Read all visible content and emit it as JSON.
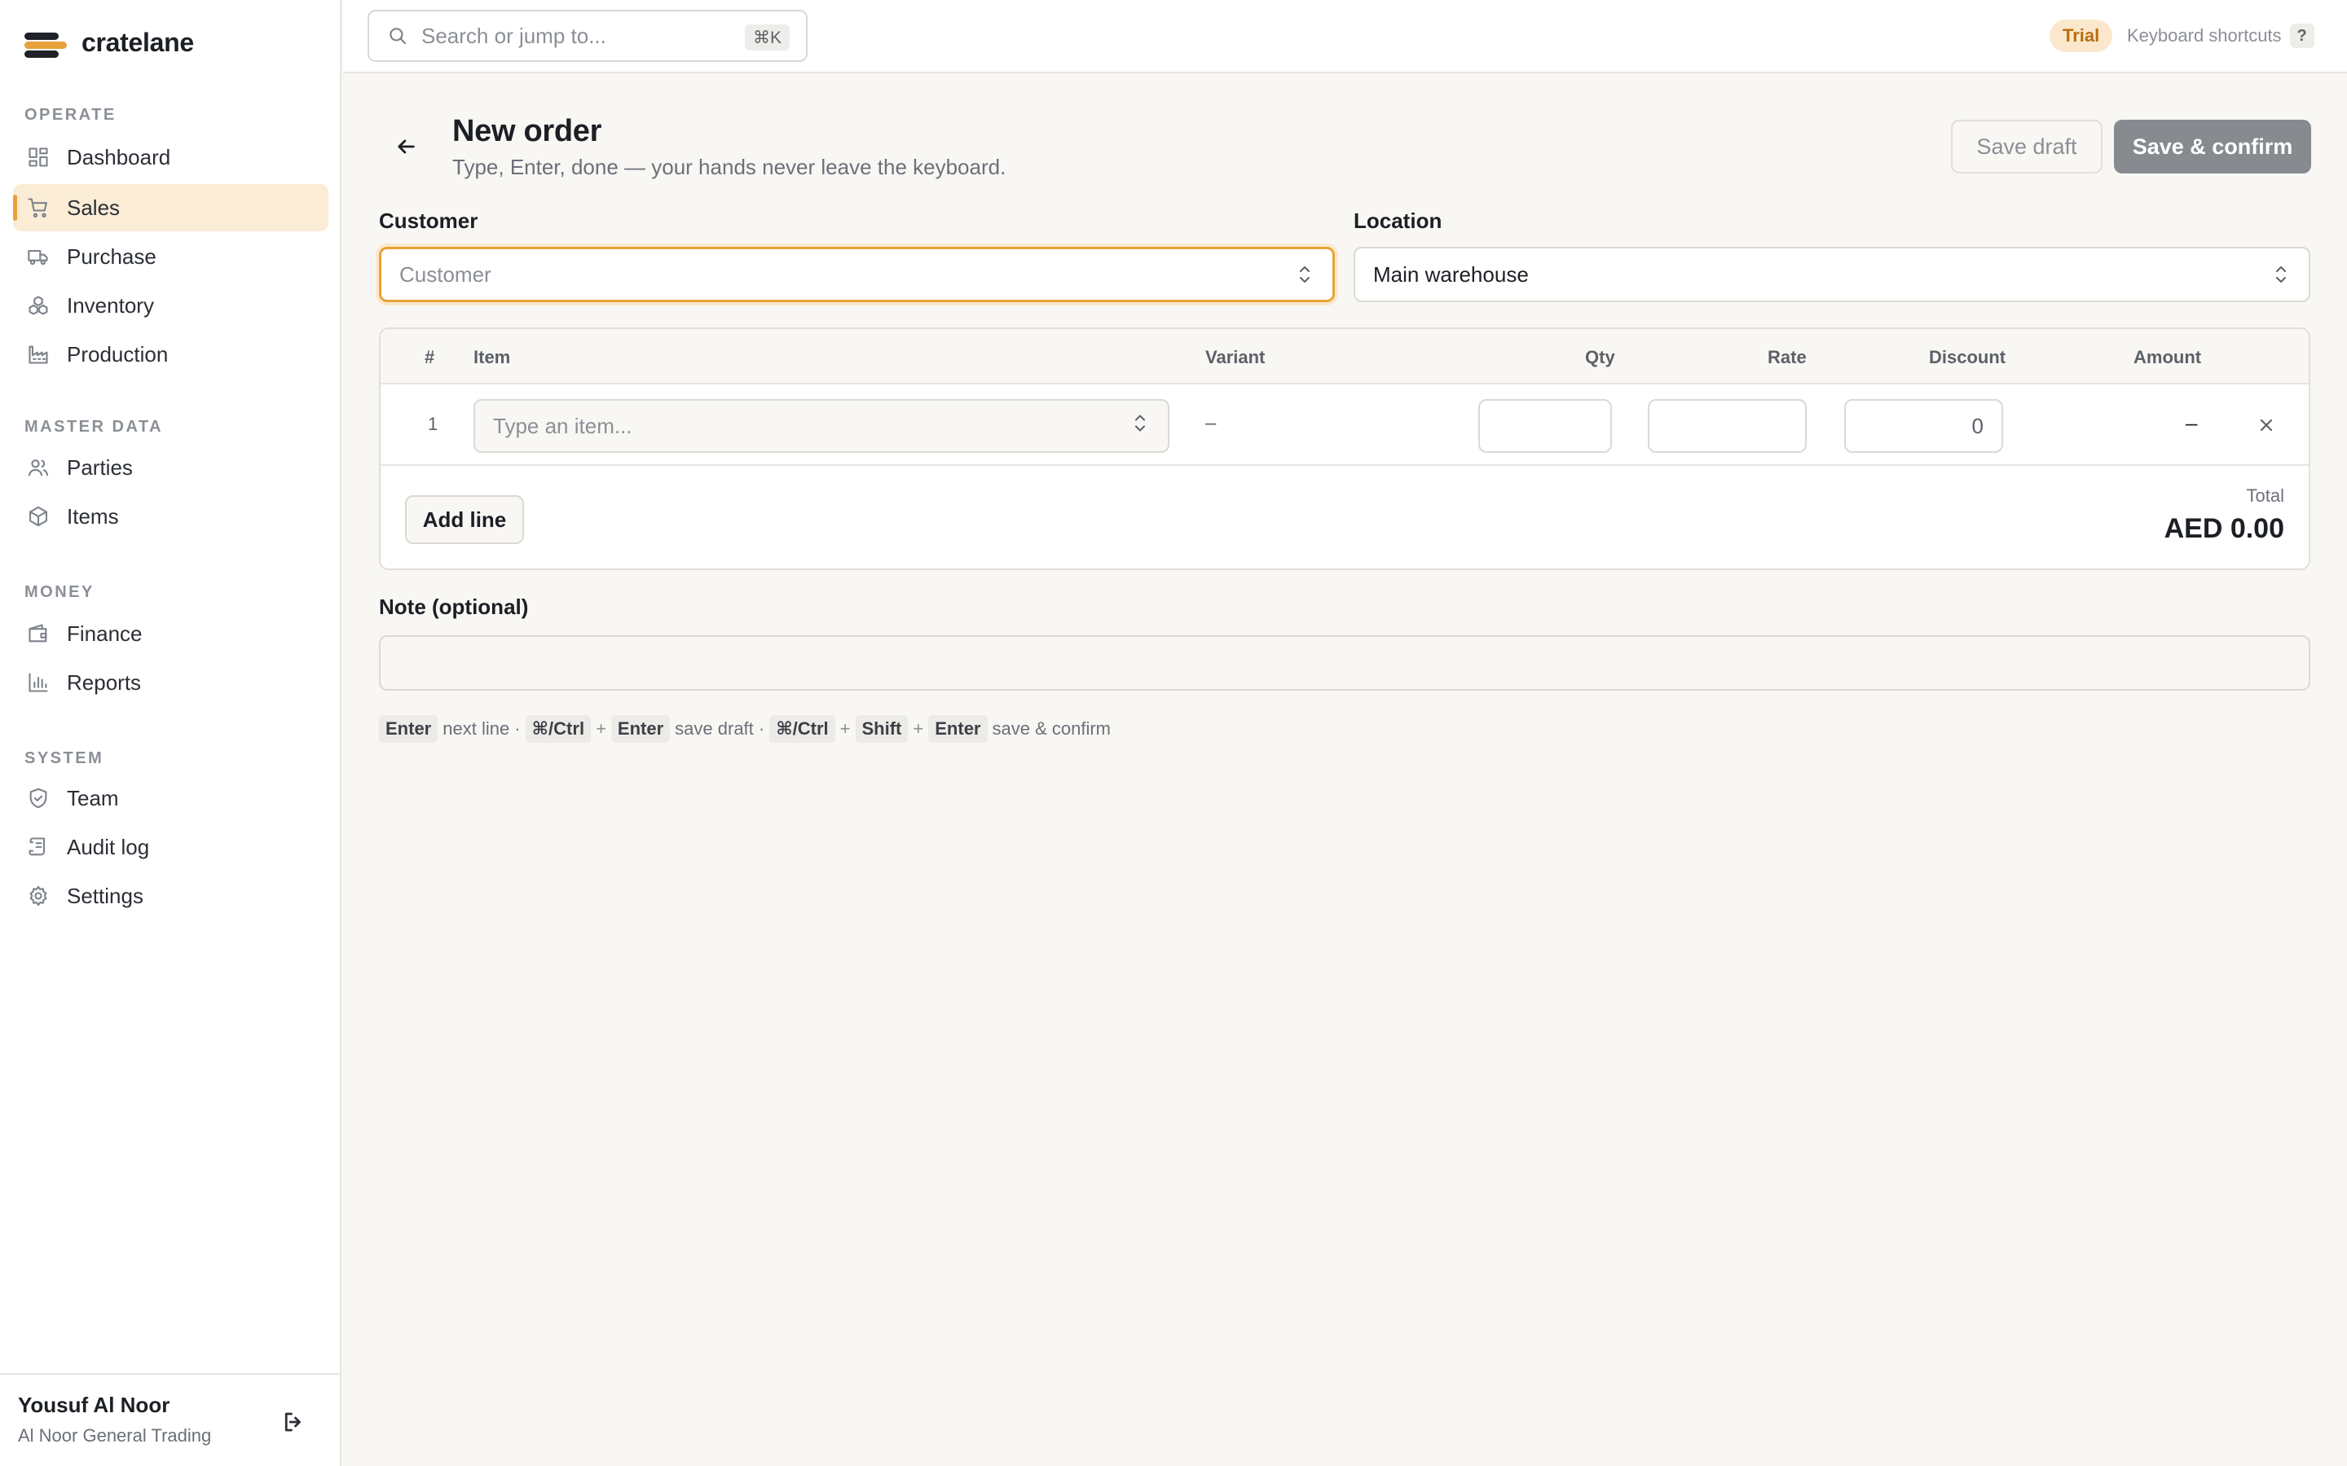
{
  "brand": {
    "name": "cratelane"
  },
  "sidebar": {
    "groups": [
      {
        "label": "OPERATE",
        "items": [
          {
            "label": "Dashboard",
            "icon": "dashboard-icon"
          },
          {
            "label": "Sales",
            "icon": "cart-icon",
            "active": true
          },
          {
            "label": "Purchase",
            "icon": "truck-icon"
          },
          {
            "label": "Inventory",
            "icon": "boxes-icon"
          },
          {
            "label": "Production",
            "icon": "factory-icon"
          }
        ]
      },
      {
        "label": "MASTER DATA",
        "items": [
          {
            "label": "Parties",
            "icon": "users-icon"
          },
          {
            "label": "Items",
            "icon": "package-icon"
          }
        ]
      },
      {
        "label": "MONEY",
        "items": [
          {
            "label": "Finance",
            "icon": "wallet-icon"
          },
          {
            "label": "Reports",
            "icon": "bar-chart-icon"
          }
        ]
      },
      {
        "label": "SYSTEM",
        "items": [
          {
            "label": "Team",
            "icon": "shield-icon"
          },
          {
            "label": "Audit log",
            "icon": "scroll-icon"
          },
          {
            "label": "Settings",
            "icon": "gear-icon"
          }
        ]
      }
    ],
    "user": {
      "name": "Yousuf Al Noor",
      "org": "Al Noor General Trading"
    }
  },
  "topbar": {
    "search_placeholder": "Search or jump to...",
    "search_shortcut": "⌘K",
    "trial_badge": "Trial",
    "shortcuts_label": "Keyboard shortcuts",
    "shortcuts_key": "?"
  },
  "page": {
    "title": "New order",
    "subtitle": "Type, Enter, done — your hands never leave the keyboard.",
    "save_draft_label": "Save draft",
    "save_confirm_label": "Save & confirm"
  },
  "form": {
    "customer": {
      "label": "Customer",
      "placeholder": "Customer"
    },
    "location": {
      "label": "Location",
      "value": "Main warehouse"
    },
    "lines": {
      "columns": {
        "num": "#",
        "item": "Item",
        "variant": "Variant",
        "qty": "Qty",
        "rate": "Rate",
        "discount": "Discount",
        "amount": "Amount"
      },
      "rows": [
        {
          "num": "1",
          "item_placeholder": "Type an item...",
          "variant": "–",
          "qty": "",
          "rate": "",
          "discount": "0",
          "amount": "–"
        }
      ],
      "add_line_label": "Add line",
      "total_label": "Total",
      "total_value": "AED 0.00"
    },
    "note": {
      "label": "Note (optional)",
      "value": ""
    }
  },
  "hints": {
    "enter_key": "Enter",
    "enter_text": "next line ·",
    "draft_mod": "⌘/Ctrl",
    "plus1": "+",
    "draft_key": "Enter",
    "draft_text": "save draft ·",
    "confirm_mod": "⌘/Ctrl",
    "plus2": "+",
    "confirm_shift": "Shift",
    "plus3": "+",
    "confirm_key": "Enter",
    "confirm_text": "save & confirm"
  }
}
